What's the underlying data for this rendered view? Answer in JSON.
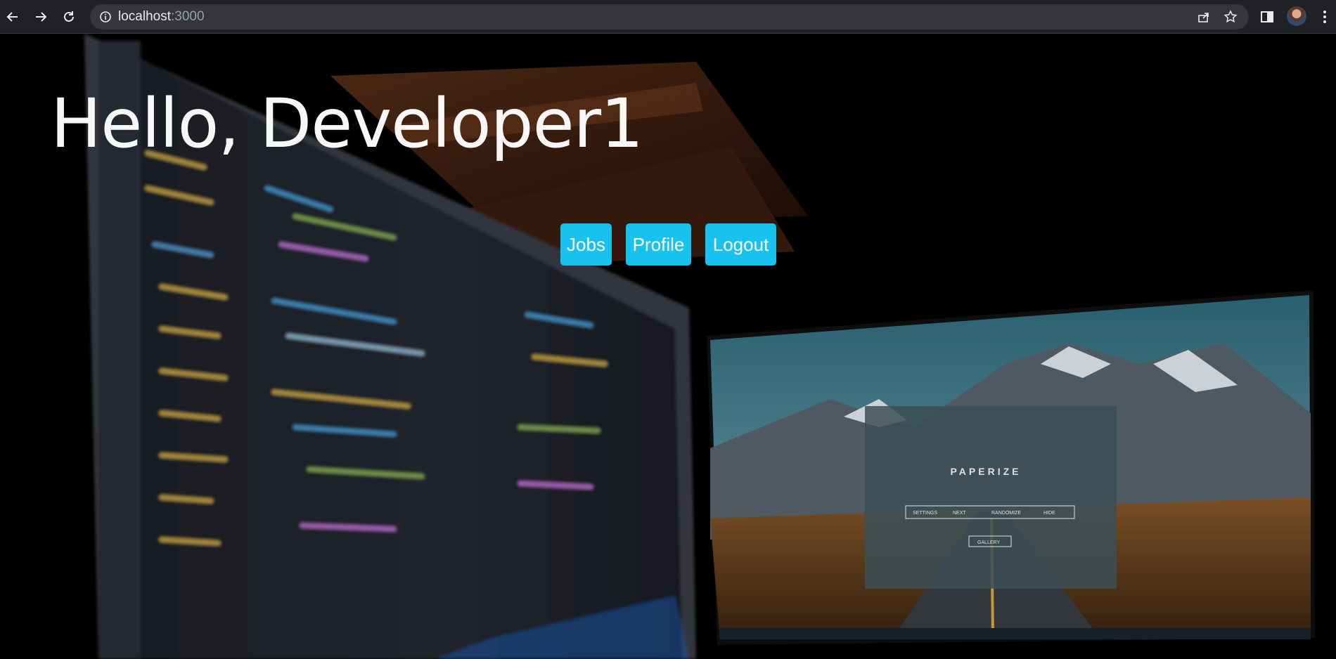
{
  "browser": {
    "url_host": "localhost",
    "url_port": ":3000"
  },
  "page": {
    "greeting": "Hello, Developer1",
    "buttons": {
      "jobs": "Jobs",
      "profile": "Profile",
      "logout": "Logout"
    },
    "button_color": "#17c3ee"
  },
  "background_image": {
    "monitor_text": "PAPERIZE",
    "monitor_menu": [
      "SETTINGS",
      "NEXT",
      "RANDOMIZE",
      "HIDE"
    ],
    "monitor_gallery": "GALLERY"
  }
}
